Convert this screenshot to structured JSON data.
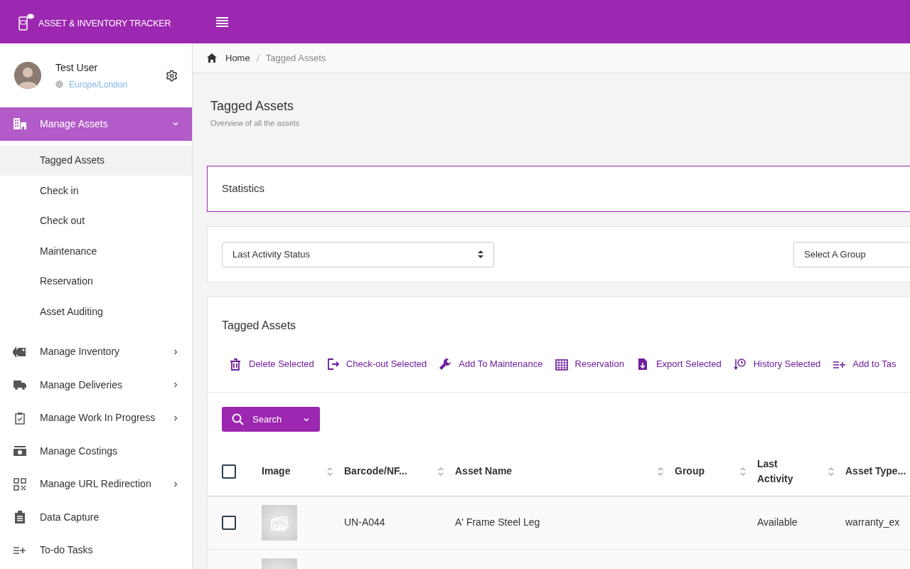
{
  "header": {
    "title": "ASSET & INVENTORY TRACKER"
  },
  "user": {
    "name": "Test User",
    "timezone": "Europe/London"
  },
  "sidebar": {
    "items": [
      {
        "label": "Manage Assets",
        "selected": true,
        "expanded": true,
        "children": [
          {
            "label": "Tagged Assets",
            "selected": true
          },
          {
            "label": "Check in",
            "selected": false
          },
          {
            "label": "Check out",
            "selected": false
          },
          {
            "label": "Maintenance",
            "selected": false
          },
          {
            "label": "Reservation",
            "selected": false
          },
          {
            "label": "Asset Auditing",
            "selected": false
          }
        ]
      },
      {
        "label": "Manage Inventory",
        "selected": false,
        "expanded": false
      },
      {
        "label": "Manage Deliveries",
        "selected": false,
        "expanded": false
      },
      {
        "label": "Manage Work In Progress",
        "selected": false,
        "expanded": false
      },
      {
        "label": "Manage Costings",
        "selected": false
      },
      {
        "label": "Manage URL Redirection",
        "selected": false,
        "expanded": false
      },
      {
        "label": "Data Capture",
        "selected": false
      },
      {
        "label": "To-do Tasks",
        "selected": false
      }
    ]
  },
  "breadcrumb": [
    "Home",
    "Tagged Assets"
  ],
  "page": {
    "title": "Tagged Assets",
    "subtitle": "Overview of all the assets"
  },
  "statistics_card": {
    "title": "Statistics"
  },
  "filters": [
    {
      "value": "Last Activity Status",
      "kind": "select"
    },
    {
      "value": "Select A Group",
      "kind": "select"
    }
  ],
  "assets_panel": {
    "title": "Tagged Assets",
    "actions": [
      "Delete Selected",
      "Check-out Selected",
      "Add To Maintenance",
      "Reservation",
      "Export Selected",
      "History Selected",
      "Add to Tas"
    ],
    "search_button": "Search",
    "table": {
      "select_all_checked": false,
      "columns": [
        {
          "label": "Image",
          "sortable": true
        },
        {
          "label": "Barcode/NF...",
          "sortable": true
        },
        {
          "label": "Asset Name",
          "sortable": true
        },
        {
          "label": "Group",
          "sortable": true
        },
        {
          "label": "Last Activity",
          "sortable": true
        },
        {
          "label": "Asset Type...",
          "sortable": false
        }
      ],
      "rows": [
        {
          "checked": false,
          "cells": [
            "",
            "UN-A044",
            "A' Frame Steel Leg",
            "",
            "Available",
            "warranty_ex"
          ]
        },
        {
          "cells": []
        }
      ]
    }
  }
}
